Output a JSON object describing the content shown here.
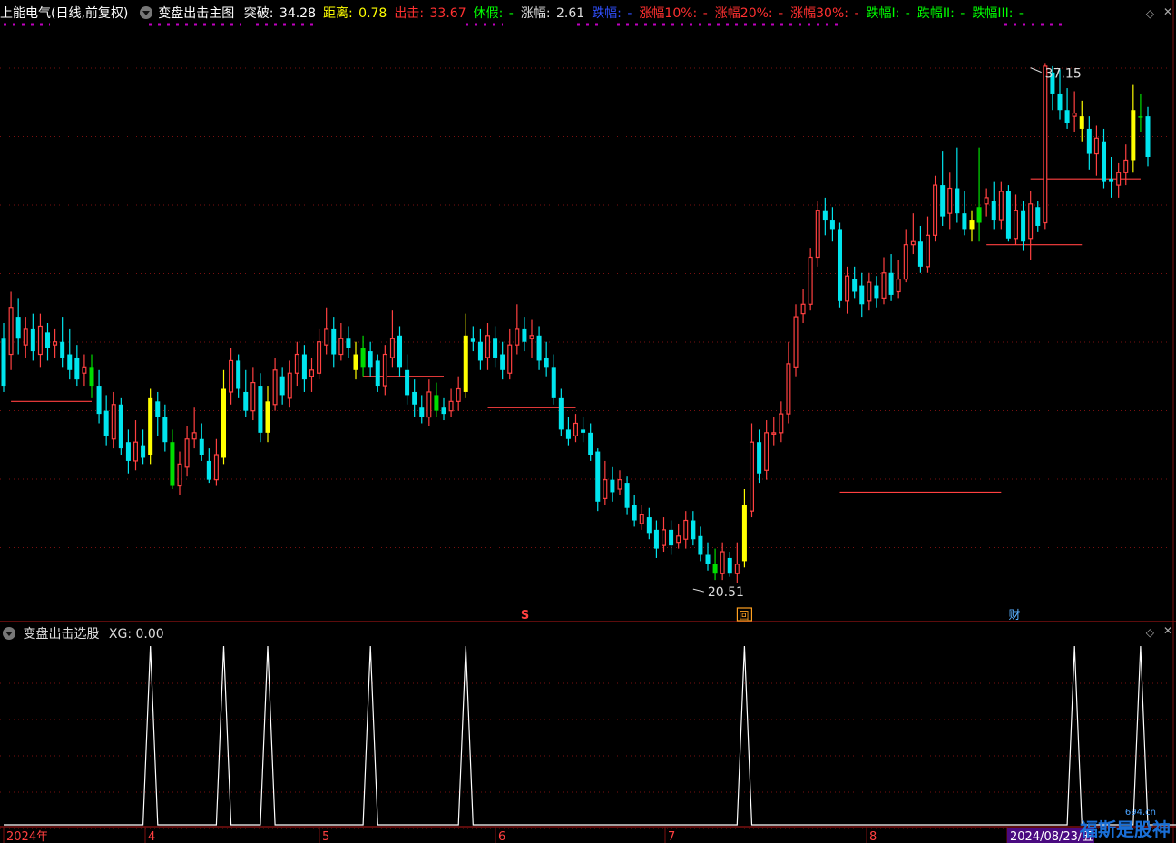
{
  "header": {
    "stock": "上能电气(日线,前复权)",
    "indicator": "变盘出击主图",
    "items": [
      {
        "label": "突破: ",
        "value": "34.28",
        "label_color": "#ffffff",
        "value_color": "#ffffff"
      },
      {
        "label": "距离: ",
        "value": "0.78",
        "label_color": "#ffff00",
        "value_color": "#ffff00"
      },
      {
        "label": "出击: ",
        "value": "33.67",
        "label_color": "#ff3030",
        "value_color": "#ff3030"
      },
      {
        "label": "休假: ",
        "value": "-",
        "label_color": "#00ff00",
        "value_color": "#00ff00"
      },
      {
        "label": "涨幅: ",
        "value": "2.61",
        "label_color": "#dddddd",
        "value_color": "#dddddd"
      },
      {
        "label": "跌幅: ",
        "value": "-",
        "label_color": "#3050ff",
        "value_color": "#3050ff"
      },
      {
        "label": "涨幅10%: ",
        "value": "-",
        "label_color": "#ff3030",
        "value_color": "#ff3030"
      },
      {
        "label": "涨幅20%: ",
        "value": "-",
        "label_color": "#ff3030",
        "value_color": "#ff3030"
      },
      {
        "label": "涨幅30%: ",
        "value": "-",
        "label_color": "#ff3030",
        "value_color": "#ff3030"
      },
      {
        "label": "跌幅I: ",
        "value": "-",
        "label_color": "#00ff00",
        "value_color": "#00ff00"
      },
      {
        "label": "跌幅II: ",
        "value": "-",
        "label_color": "#00ff00",
        "value_color": "#00ff00"
      },
      {
        "label": "跌幅III: ",
        "value": "-",
        "label_color": "#00ff00",
        "value_color": "#00ff00"
      }
    ]
  },
  "sub_header": {
    "indicator": "变盘出击选股",
    "label": "XG: ",
    "value": "0.00"
  },
  "markers": {
    "s_label": "S",
    "hui_label": "回",
    "cai_label": "财"
  },
  "annotations": {
    "high_label": "37.15",
    "low_label": "20.51"
  },
  "x_axis_labels": [
    "2024年",
    "4",
    "5",
    "6",
    "7",
    "8",
    "2024/08/23/五"
  ],
  "watermark": {
    "text": "福斯是股神",
    "small": "694.cn"
  },
  "colors": {
    "up": "#ff4040",
    "down": "#00e5ee",
    "yellow": "#ffff00",
    "green": "#00dd00",
    "grid": "#7a1010",
    "xg": "#ffffff",
    "magenta": "#c000c0"
  },
  "chart_data": [
    {
      "type": "candlestick",
      "ylim": [
        19.5,
        38.5
      ],
      "high_annotation": {
        "index": 140,
        "value": 37.15
      },
      "low_annotation": {
        "index": 94,
        "value": 20.51
      },
      "candles": [
        [
          28.5,
          27.0,
          29.0,
          26.8
        ],
        [
          28.0,
          29.5,
          30.0,
          27.5
        ],
        [
          29.2,
          28.5,
          29.8,
          28.0
        ],
        [
          28.3,
          28.8,
          29.2,
          27.9
        ],
        [
          28.8,
          28.1,
          29.3,
          27.8
        ],
        [
          28.0,
          28.9,
          29.3,
          27.6
        ],
        [
          28.7,
          28.2,
          29.0,
          27.8
        ],
        [
          28.3,
          28.4,
          28.8,
          27.9
        ],
        [
          28.4,
          27.9,
          29.2,
          27.6
        ],
        [
          28.0,
          27.5,
          28.8,
          27.2
        ],
        [
          27.9,
          27.2,
          28.3,
          27.0
        ],
        [
          27.4,
          27.6,
          28.0,
          27.0
        ],
        [
          27.6,
          27.0,
          28.0,
          26.6
        ],
        [
          27.0,
          26.1,
          27.5,
          25.8
        ],
        [
          26.2,
          25.4,
          26.7,
          25.1
        ],
        [
          25.3,
          26.4,
          26.8,
          25.0
        ],
        [
          26.4,
          25.0,
          26.6,
          24.8
        ],
        [
          25.2,
          24.6,
          25.6,
          24.2
        ],
        [
          24.6,
          25.2,
          25.9,
          24.3
        ],
        [
          25.1,
          24.7,
          25.6,
          24.5
        ],
        [
          24.8,
          26.6,
          26.9,
          24.5
        ],
        [
          26.5,
          26.0,
          26.8,
          25.4
        ],
        [
          26.0,
          25.2,
          26.4,
          24.9
        ],
        [
          25.2,
          23.8,
          25.6,
          23.7
        ],
        [
          23.8,
          24.5,
          24.9,
          23.5
        ],
        [
          24.4,
          25.3,
          25.7,
          24.1
        ],
        [
          25.3,
          25.5,
          26.3,
          25.0
        ],
        [
          25.3,
          24.8,
          25.8,
          24.6
        ],
        [
          24.6,
          24.0,
          25.0,
          23.9
        ],
        [
          24.0,
          24.8,
          25.3,
          23.8
        ],
        [
          24.7,
          26.9,
          27.5,
          24.5
        ],
        [
          26.8,
          27.8,
          28.2,
          26.4
        ],
        [
          27.8,
          26.9,
          28.0,
          26.6
        ],
        [
          26.8,
          26.2,
          27.5,
          26.0
        ],
        [
          26.2,
          27.1,
          27.6,
          25.9
        ],
        [
          27.0,
          25.5,
          27.4,
          25.2
        ],
        [
          25.5,
          26.5,
          27.0,
          25.2
        ],
        [
          26.4,
          27.5,
          27.9,
          26.2
        ],
        [
          27.3,
          26.7,
          27.6,
          26.4
        ],
        [
          26.6,
          27.4,
          27.8,
          26.3
        ],
        [
          27.4,
          28.0,
          28.4,
          27.0
        ],
        [
          28.0,
          27.2,
          28.3,
          26.8
        ],
        [
          27.3,
          27.5,
          27.9,
          26.8
        ],
        [
          27.4,
          28.4,
          28.8,
          27.2
        ],
        [
          28.3,
          28.8,
          29.5,
          28.0
        ],
        [
          28.8,
          28.0,
          29.2,
          27.6
        ],
        [
          28.0,
          28.5,
          29.0,
          27.8
        ],
        [
          28.5,
          28.2,
          28.9,
          27.9
        ],
        [
          28.0,
          27.5,
          28.4,
          27.2
        ],
        [
          27.6,
          28.2,
          28.6,
          27.3
        ],
        [
          28.1,
          27.6,
          28.4,
          27.3
        ],
        [
          27.8,
          27.0,
          28.0,
          26.8
        ],
        [
          27.0,
          28.0,
          28.3,
          26.7
        ],
        [
          27.9,
          28.5,
          29.4,
          27.6
        ],
        [
          28.6,
          27.6,
          28.9,
          27.3
        ],
        [
          27.5,
          26.7,
          28.0,
          26.4
        ],
        [
          26.8,
          26.4,
          27.2,
          26.0
        ],
        [
          26.3,
          26.0,
          26.7,
          25.8
        ],
        [
          26.0,
          26.8,
          27.2,
          25.7
        ],
        [
          26.7,
          26.2,
          27.1,
          26.0
        ],
        [
          26.3,
          26.1,
          26.6,
          25.9
        ],
        [
          26.2,
          26.5,
          26.9,
          26.0
        ],
        [
          26.5,
          26.9,
          27.3,
          26.2
        ],
        [
          26.8,
          28.6,
          29.3,
          26.6
        ],
        [
          28.5,
          28.4,
          28.9,
          28.1
        ],
        [
          28.4,
          27.8,
          28.8,
          27.5
        ],
        [
          27.9,
          28.6,
          29.0,
          27.5
        ],
        [
          28.5,
          27.9,
          28.9,
          27.6
        ],
        [
          28.0,
          27.5,
          28.4,
          27.2
        ],
        [
          27.4,
          28.3,
          28.8,
          27.2
        ],
        [
          28.3,
          28.8,
          29.6,
          28.0
        ],
        [
          28.8,
          28.4,
          29.2,
          28.1
        ],
        [
          28.5,
          28.6,
          29.1,
          27.9
        ],
        [
          28.6,
          27.8,
          28.9,
          27.5
        ],
        [
          27.9,
          27.6,
          28.4,
          27.3
        ],
        [
          27.6,
          26.6,
          28.0,
          26.4
        ],
        [
          26.6,
          25.6,
          26.9,
          25.4
        ],
        [
          25.6,
          25.3,
          26.0,
          25.1
        ],
        [
          25.4,
          25.8,
          26.1,
          25.2
        ],
        [
          25.6,
          25.5,
          26.0,
          25.2
        ],
        [
          25.5,
          24.8,
          25.8,
          24.6
        ],
        [
          24.9,
          23.3,
          25.0,
          23.0
        ],
        [
          23.4,
          24.0,
          24.6,
          23.2
        ],
        [
          24.0,
          23.6,
          24.4,
          23.3
        ],
        [
          23.7,
          24.0,
          24.3,
          23.5
        ],
        [
          23.9,
          23.1,
          24.1,
          22.9
        ],
        [
          23.2,
          22.7,
          23.5,
          22.5
        ],
        [
          22.6,
          22.9,
          23.2,
          22.4
        ],
        [
          22.8,
          22.3,
          23.1,
          22.1
        ],
        [
          22.4,
          21.8,
          22.7,
          21.5
        ],
        [
          21.9,
          22.4,
          22.8,
          21.7
        ],
        [
          22.4,
          21.9,
          22.7,
          21.6
        ],
        [
          22.0,
          22.2,
          22.6,
          21.8
        ],
        [
          22.1,
          22.7,
          23.0,
          21.8
        ],
        [
          22.7,
          22.1,
          23.0,
          21.9
        ],
        [
          22.2,
          21.6,
          22.5,
          21.4
        ],
        [
          21.6,
          21.3,
          22.0,
          21.1
        ],
        [
          21.3,
          21.0,
          21.8,
          20.8
        ],
        [
          21.0,
          21.7,
          22.0,
          20.8
        ],
        [
          21.5,
          21.0,
          21.7,
          20.9
        ],
        [
          21.0,
          21.3,
          22.0,
          20.7
        ],
        [
          21.4,
          23.2,
          23.7,
          21.2
        ],
        [
          23.0,
          25.2,
          25.8,
          22.8
        ],
        [
          25.2,
          24.2,
          25.6,
          23.9
        ],
        [
          24.3,
          25.5,
          25.9,
          24.0
        ],
        [
          25.5,
          25.5,
          26.0,
          25.1
        ],
        [
          25.5,
          26.1,
          26.5,
          25.2
        ],
        [
          26.1,
          27.7,
          28.4,
          25.8
        ],
        [
          27.6,
          29.2,
          29.6,
          27.3
        ],
        [
          29.3,
          29.6,
          30.1,
          29.0
        ],
        [
          29.6,
          31.1,
          31.4,
          29.4
        ],
        [
          31.1,
          32.6,
          32.9,
          30.8
        ],
        [
          32.6,
          32.3,
          33.0,
          31.8
        ],
        [
          32.3,
          32.0,
          32.7,
          31.6
        ],
        [
          32.0,
          29.7,
          32.2,
          29.5
        ],
        [
          29.7,
          30.5,
          30.8,
          29.3
        ],
        [
          30.4,
          30.0,
          30.8,
          29.8
        ],
        [
          30.2,
          29.6,
          30.6,
          29.2
        ],
        [
          29.7,
          30.3,
          30.6,
          29.4
        ],
        [
          30.2,
          29.8,
          30.5,
          29.5
        ],
        [
          29.8,
          30.6,
          31.1,
          29.6
        ],
        [
          30.6,
          29.9,
          31.2,
          29.7
        ],
        [
          30.0,
          30.4,
          31.0,
          29.8
        ],
        [
          30.4,
          31.5,
          32.0,
          30.3
        ],
        [
          31.5,
          31.6,
          32.5,
          31.2
        ],
        [
          31.6,
          30.8,
          32.1,
          30.6
        ],
        [
          30.8,
          31.8,
          32.4,
          30.6
        ],
        [
          31.8,
          33.4,
          33.7,
          31.6
        ],
        [
          33.4,
          32.4,
          34.5,
          32.1
        ],
        [
          32.5,
          33.3,
          33.8,
          32.0
        ],
        [
          33.3,
          32.5,
          34.6,
          32.2
        ],
        [
          32.5,
          32.0,
          33.2,
          31.8
        ],
        [
          32.0,
          32.3,
          32.6,
          31.6
        ],
        [
          32.2,
          32.7,
          34.6,
          31.6
        ],
        [
          32.8,
          33.0,
          33.3,
          32.4
        ],
        [
          32.9,
          32.3,
          33.5,
          32.0
        ],
        [
          32.3,
          33.2,
          33.5,
          32.0
        ],
        [
          33.2,
          31.7,
          33.4,
          31.6
        ],
        [
          31.7,
          32.6,
          33.1,
          31.5
        ],
        [
          32.6,
          31.6,
          32.9,
          31.3
        ],
        [
          31.7,
          32.8,
          33.2,
          31.0
        ],
        [
          32.7,
          32.1,
          32.9,
          31.9
        ],
        [
          32.2,
          37.2,
          37.3,
          32.0
        ],
        [
          37.0,
          36.3,
          37.2,
          35.8
        ],
        [
          36.3,
          35.8,
          37.1,
          35.5
        ],
        [
          35.8,
          35.4,
          36.5,
          35.2
        ],
        [
          35.6,
          35.7,
          36.4,
          35.1
        ],
        [
          35.6,
          35.2,
          36.1,
          34.8
        ],
        [
          35.2,
          34.4,
          35.6,
          33.9
        ],
        [
          34.4,
          34.9,
          35.3,
          33.7
        ],
        [
          34.8,
          33.5,
          35.2,
          33.3
        ],
        [
          33.6,
          33.5,
          34.3,
          33.0
        ],
        [
          33.4,
          33.8,
          34.1,
          33.0
        ],
        [
          33.8,
          34.2,
          34.7,
          33.4
        ],
        [
          34.2,
          35.8,
          36.6,
          33.8
        ],
        [
          35.6,
          35.6,
          36.3,
          35.1
        ],
        [
          35.6,
          34.3,
          35.9,
          34.0
        ]
      ],
      "yellow_candles": [
        20,
        30,
        36,
        48,
        63,
        97,
        101,
        132,
        147,
        154
      ],
      "green_candles": [
        12,
        23,
        49,
        59,
        97,
        133,
        155
      ],
      "red_levels": [
        {
          "start": 1,
          "end": 12,
          "value": 26.5
        },
        {
          "start": 49,
          "end": 60,
          "value": 27.3
        },
        {
          "start": 66,
          "end": 78,
          "value": 26.3
        },
        {
          "start": 114,
          "end": 136,
          "value": 23.6
        },
        {
          "start": 134,
          "end": 147,
          "value": 31.5
        },
        {
          "start": 140,
          "end": 155,
          "value": 33.6
        }
      ]
    },
    {
      "type": "line",
      "series": [
        {
          "values": [
            0,
            0,
            0,
            0,
            0,
            0,
            0,
            0,
            0,
            0,
            0,
            0,
            0,
            0,
            0,
            0,
            0,
            0,
            0,
            0,
            1,
            0,
            0,
            0,
            0,
            0,
            0,
            0,
            0,
            0,
            1,
            0,
            0,
            0,
            0,
            0,
            1,
            0,
            0,
            0,
            0,
            0,
            0,
            0,
            0,
            0,
            0,
            0,
            0,
            0,
            1,
            0,
            0,
            0,
            0,
            0,
            0,
            0,
            0,
            0,
            0,
            0,
            0,
            1,
            0,
            0,
            0,
            0,
            0,
            0,
            0,
            0,
            0,
            0,
            0,
            0,
            0,
            0,
            0,
            0,
            0,
            0,
            0,
            0,
            0,
            0,
            0,
            0,
            0,
            0,
            0,
            0,
            0,
            0,
            0,
            0,
            0,
            0,
            0,
            0,
            0,
            1,
            0,
            0,
            0,
            0,
            0,
            0,
            0,
            0,
            0,
            0,
            0,
            0,
            0,
            0,
            0,
            0,
            0,
            0,
            0,
            0,
            0,
            0,
            0,
            0,
            0,
            0,
            0,
            0,
            0,
            0,
            0,
            0,
            0,
            0,
            0,
            0,
            0,
            0,
            0,
            0,
            0,
            0,
            0,
            0,
            1,
            0,
            0,
            0,
            0,
            0,
            0,
            0,
            0,
            1,
            0,
            0,
            0,
            0,
            0,
            0,
            0
          ]
        }
      ],
      "ylim": [
        0,
        1
      ]
    }
  ]
}
